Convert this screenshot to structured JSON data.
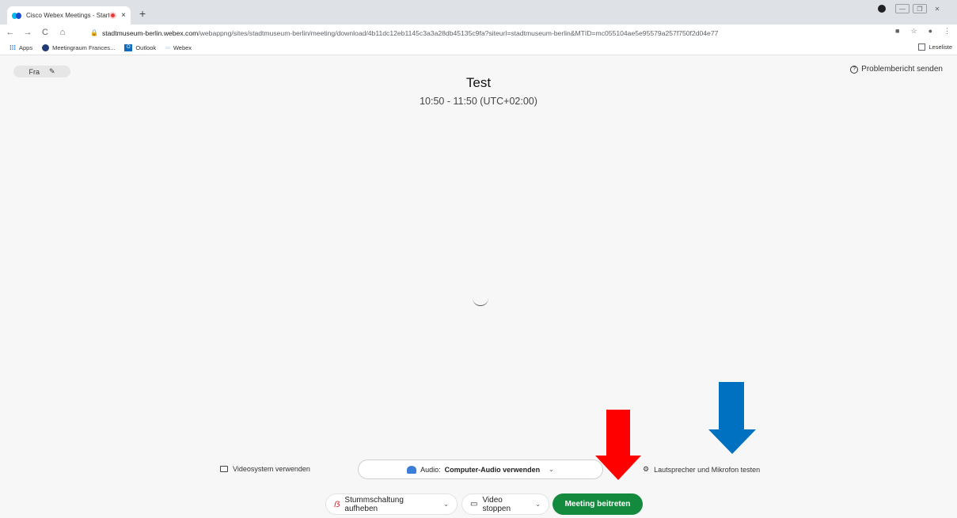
{
  "browser": {
    "tab_title": "Cisco Webex Meetings - Start",
    "tab_close": "×",
    "new_tab": "+",
    "url_host": "stadtmuseum-berlin.webex.com",
    "url_path": "/webappng/sites/stadtmuseum-berlin/meeting/download/4b11dc12eb1145c3a3a28db45135c9fa?siteurl=stadtmuseum-berlin&MTID=mc055104ae5e95579a257f750f2d04e77",
    "nav": {
      "back": "←",
      "forward": "→",
      "reload": "C",
      "home": "⌂"
    },
    "bookmarks": [
      {
        "label": "Apps",
        "icon": "apps-grid-icon"
      },
      {
        "label": "Meetingraum Frances...",
        "icon": "webex-circle-icon"
      },
      {
        "label": "Outlook",
        "icon": "outlook-icon"
      },
      {
        "label": "Webex",
        "icon": "webex-icon"
      }
    ],
    "reading_list": "Leseliste"
  },
  "meeting": {
    "name_pill": "Fra",
    "report_label": "Problembericht senden",
    "title": "Test",
    "time": "10:50 - 11:50 (UTC+02:00)",
    "video_system": "Videosystem verwenden",
    "audio_prefix": "Audio:",
    "audio_value": "Computer-Audio verwenden",
    "speaker_test": "Lautsprecher und Mikrofon testen",
    "unmute": "Stummschaltung aufheben",
    "video_stop": "Video stoppen",
    "join": "Meeting beitreten"
  },
  "colors": {
    "join_button": "#138a3d",
    "arrow_red": "#ff0000",
    "arrow_blue": "#0070c0"
  }
}
